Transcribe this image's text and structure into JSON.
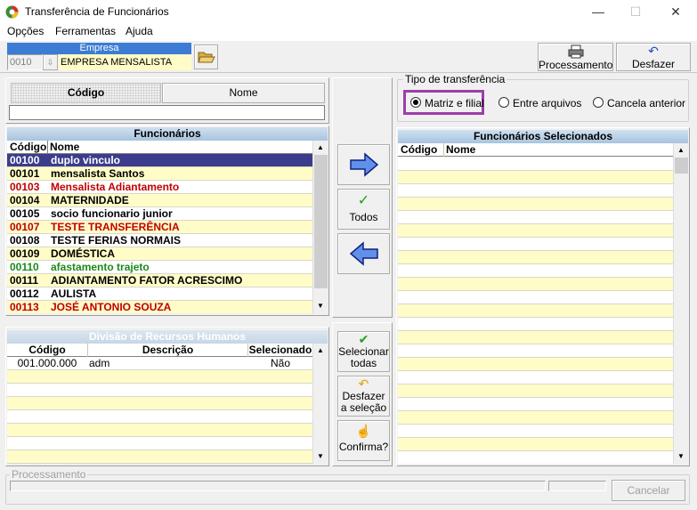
{
  "window": {
    "title": "Transferência de Funcionários",
    "minimize": "—",
    "maximize": "☐",
    "close": "✕"
  },
  "menu": [
    {
      "label": "Opções"
    },
    {
      "label": "Ferramentas"
    },
    {
      "label": "Ajuda"
    }
  ],
  "empresa": {
    "label": "Empresa",
    "code": "0010",
    "name": "EMPRESA MENSALISTA"
  },
  "toolbar": {
    "processamento": "Processamento",
    "desfazer": "Desfazer"
  },
  "search": {
    "tab_codigo": "Código",
    "tab_nome": "Nome",
    "value": ""
  },
  "funcionarios": {
    "title": "Funcionários",
    "col_codigo": "Código",
    "col_nome": "Nome",
    "rows": [
      {
        "codigo": "00100",
        "nome": "duplo vinculo",
        "color": "#ffffff",
        "selected": true
      },
      {
        "codigo": "00101",
        "nome": "mensalista Santos",
        "color": "#000000"
      },
      {
        "codigo": "00103",
        "nome": "Mensalista Adiantamento",
        "color": "#c00000"
      },
      {
        "codigo": "00104",
        "nome": "MATERNIDADE",
        "color": "#000000"
      },
      {
        "codigo": "00105",
        "nome": "socio funcionario junior",
        "color": "#000000"
      },
      {
        "codigo": "00107",
        "nome": "TESTE TRANSFERÊNCIA",
        "color": "#c00000"
      },
      {
        "codigo": "00108",
        "nome": "TESTE FERIAS NORMAIS",
        "color": "#000000"
      },
      {
        "codigo": "00109",
        "nome": "DOMÉSTICA",
        "color": "#000000"
      },
      {
        "codigo": "00110",
        "nome": "afastamento trajeto",
        "color": "#1a8a1a"
      },
      {
        "codigo": "00111",
        "nome": "ADIANTAMENTO FATOR ACRESCIMO",
        "color": "#000000"
      },
      {
        "codigo": "00112",
        "nome": "AULISTA",
        "color": "#000000"
      },
      {
        "codigo": "00113",
        "nome": "JOSÉ ANTONIO SOUZA",
        "color": "#c00000"
      }
    ]
  },
  "divisao": {
    "title": "Divisão de Recursos Humanos",
    "col_codigo": "Código",
    "col_descricao": "Descrição",
    "col_selecionado": "Selecionado",
    "rows": [
      {
        "codigo": "001.000.000",
        "descricao": "adm",
        "selecionado": "Não"
      }
    ]
  },
  "middle": {
    "todos": "Todos",
    "selecionar_todas": "Selecionar todas",
    "desfazer_selecao": "Desfazer a seleção",
    "confirma": "Confirma?"
  },
  "tipo": {
    "title": "Tipo de transferência",
    "options": [
      {
        "label": "Matriz e filial",
        "selected": true
      },
      {
        "label": "Entre arquivos",
        "selected": false
      },
      {
        "label": "Cancela anterior",
        "selected": false
      }
    ]
  },
  "selecionados": {
    "title": "Funcionários Selecionados",
    "col_codigo": "Código",
    "col_nome": "Nome"
  },
  "processamento": {
    "label": "Processamento",
    "cancelar": "Cancelar"
  },
  "colors": {
    "selected_row": "#3c3c8c",
    "row_bg": "#fffcc8",
    "highlight_frame": "#9b3fa8"
  }
}
